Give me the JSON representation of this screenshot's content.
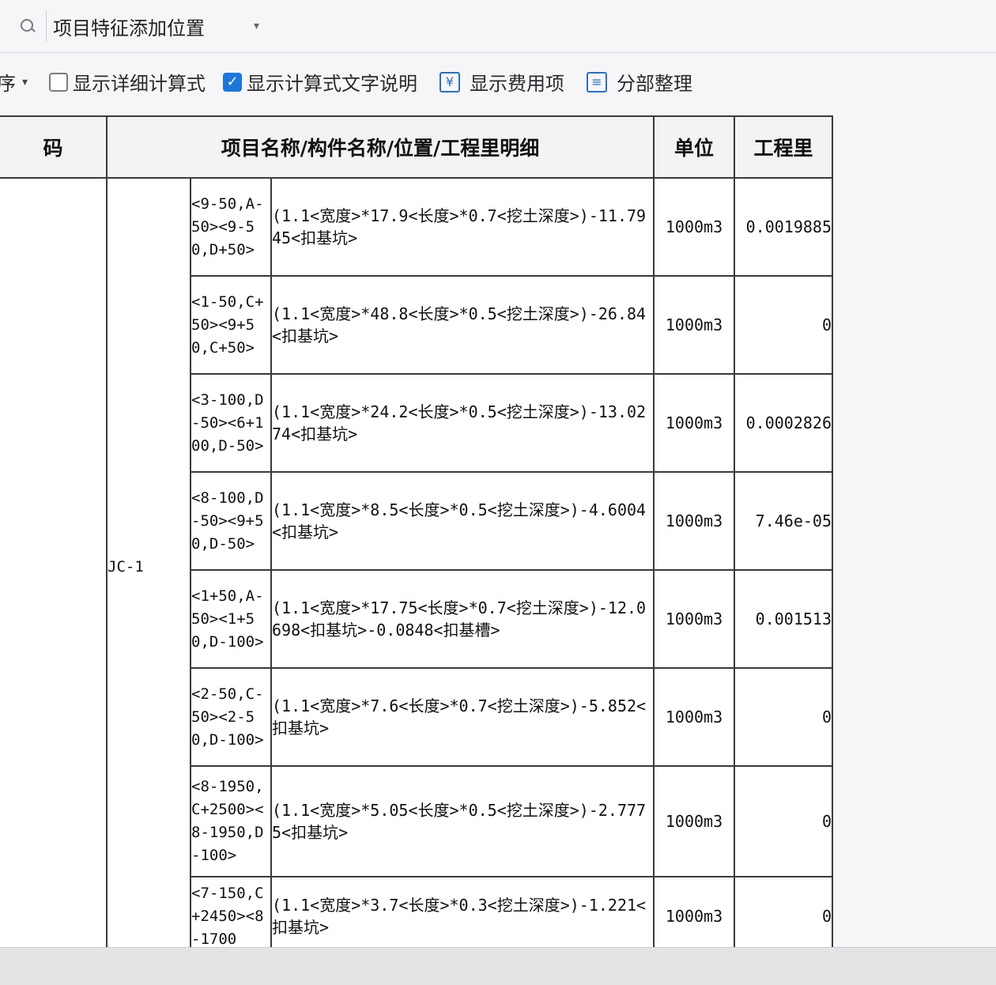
{
  "search": {
    "value": "项目特征添加位置",
    "dropdown": "▾"
  },
  "toolbar": {
    "sort_label": "序",
    "sort_caret": "▾",
    "show_detail_formula": "显示详细计算式",
    "show_formula_text": "显示计算式文字说明",
    "fee_icon": "¥",
    "show_fee_items": "显示费用项",
    "section_icon": "≡",
    "section_organize": "分部整理",
    "checkmark": "✓"
  },
  "table": {
    "headers": {
      "code": "码",
      "name": "项目名称/构件名称/位置/工程里明细",
      "unit": "单位",
      "quantity": "工程里"
    },
    "component": "JC-1",
    "rows": [
      {
        "position": "<9-50,A-50><9-50,D+50>",
        "formula": "(1.1<宽度>*17.9<长度>*0.7<挖土深度>)-11.7945<扣基坑>",
        "unit": "1000m3",
        "quantity": "0.0019885"
      },
      {
        "position": "<1-50,C+50><9+50,C+50>",
        "formula": "(1.1<宽度>*48.8<长度>*0.5<挖土深度>)-26.84<扣基坑>",
        "unit": "1000m3",
        "quantity": "0"
      },
      {
        "position": "<3-100,D-50><6+100,D-50>",
        "formula": "(1.1<宽度>*24.2<长度>*0.5<挖土深度>)-13.0274<扣基坑>",
        "unit": "1000m3",
        "quantity": "0.0002826"
      },
      {
        "position": "<8-100,D-50><9+50,D-50>",
        "formula": "(1.1<宽度>*8.5<长度>*0.5<挖土深度>)-4.6004<扣基坑>",
        "unit": "1000m3",
        "quantity": "7.46e-05"
      },
      {
        "position": "<1+50,A-50><1+50,D-100>",
        "formula": "(1.1<宽度>*17.75<长度>*0.7<挖土深度>)-12.0698<扣基坑>-0.0848<扣基槽>",
        "unit": "1000m3",
        "quantity": "0.001513"
      },
      {
        "position": "<2-50,C-50><2-50,D-100>",
        "formula": "(1.1<宽度>*7.6<长度>*0.7<挖土深度>)-5.852<扣基坑>",
        "unit": "1000m3",
        "quantity": "0"
      },
      {
        "position": "<8-1950,C+2500><8-1950,D-100>",
        "formula": "(1.1<宽度>*5.05<长度>*0.5<挖土深度>)-2.7775<扣基坑>",
        "unit": "1000m3",
        "quantity": "0"
      },
      {
        "position": "<7-150,C+2450><8-1700",
        "formula": "(1.1<宽度>*3.7<长度>*0.3<挖土深度>)-1.221<扣基坑>",
        "unit": "1000m3",
        "quantity": "0"
      }
    ]
  }
}
